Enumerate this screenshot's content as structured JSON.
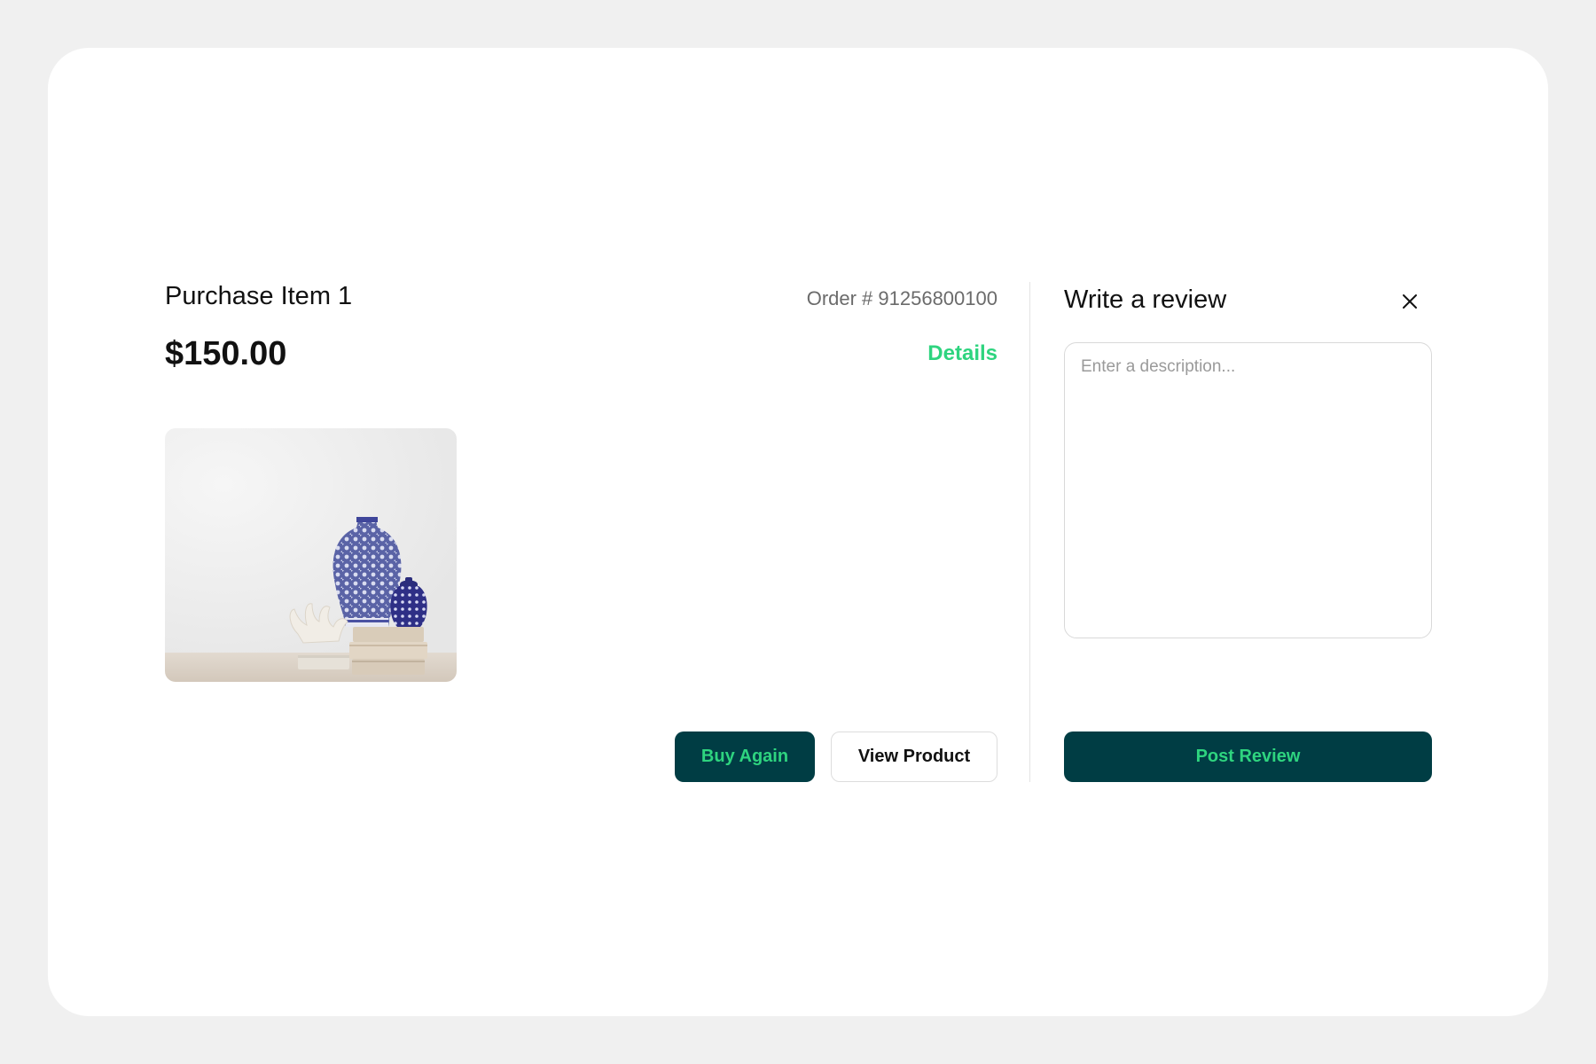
{
  "purchase": {
    "title": "Purchase Item 1",
    "price": "$150.00",
    "order_number": "Order # 91256800100",
    "details_link": "Details",
    "image_alt": "Blue and white porcelain vases on books with white coral"
  },
  "actions": {
    "buy_again_label": "Buy Again",
    "view_product_label": "View Product"
  },
  "review": {
    "title": "Write a review",
    "description_placeholder": "Enter a description...",
    "description_value": "",
    "post_label": "Post Review",
    "close_icon": "close-icon"
  },
  "colors": {
    "page_background": "#f0f0f0",
    "card_background": "#ffffff",
    "primary_dark": "#003d44",
    "accent_green": "#2ed47f",
    "text_muted": "#6b6b6b"
  }
}
